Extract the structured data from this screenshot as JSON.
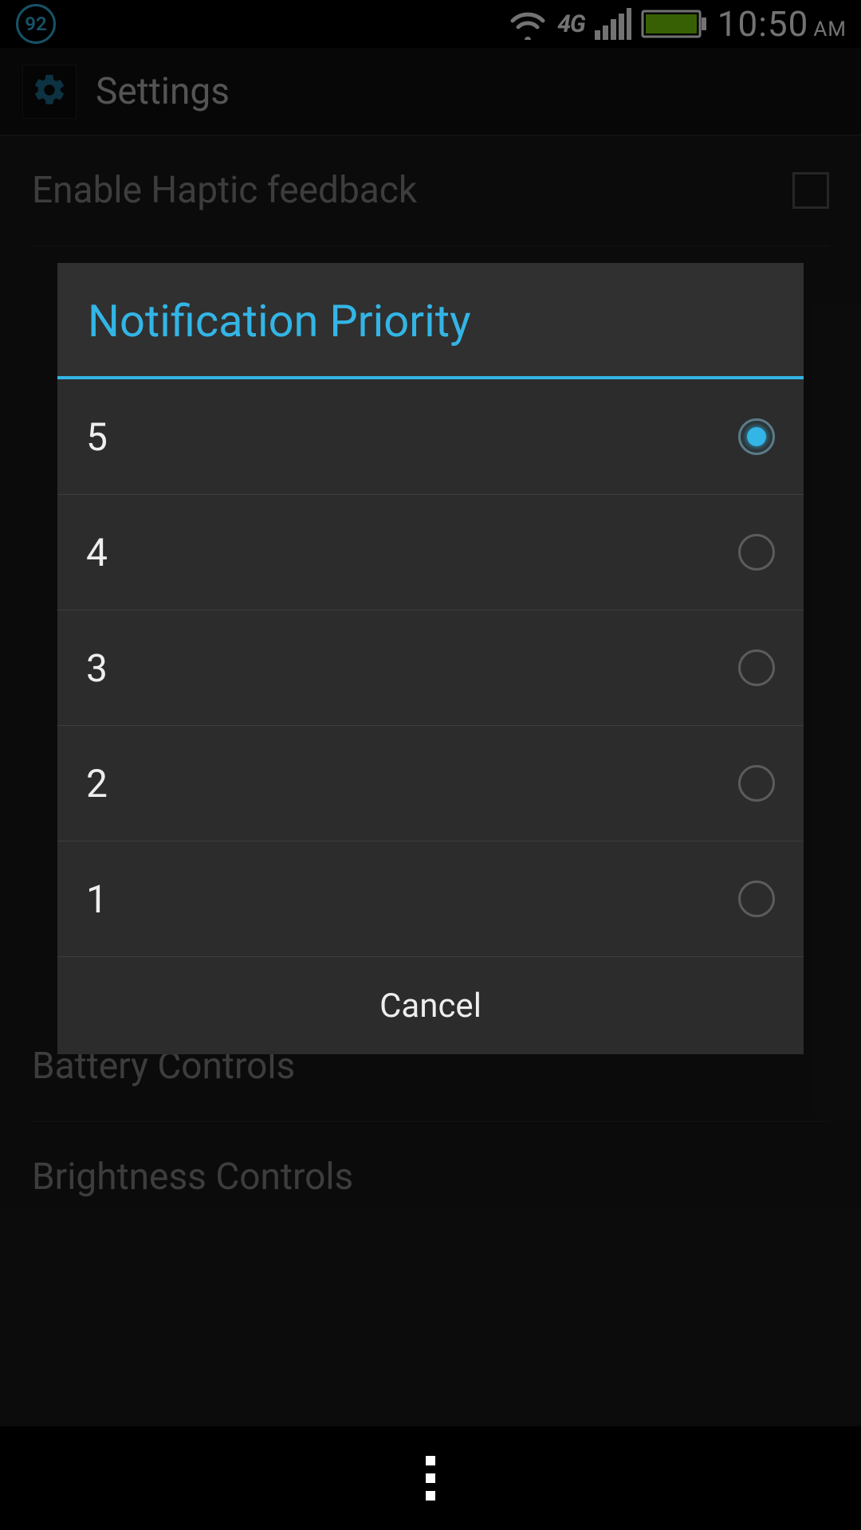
{
  "status_bar": {
    "badge_value": "92",
    "network_label": "4G",
    "time": "10:50",
    "ampm": "AM"
  },
  "app_bar": {
    "title": "Settings"
  },
  "settings_list": {
    "items": [
      {
        "label": "Enable Haptic feedback"
      },
      {
        "label": "Battery Controls"
      },
      {
        "label": "Brightness Controls"
      }
    ]
  },
  "dialog": {
    "title": "Notification Priority",
    "options": [
      {
        "label": "5",
        "selected": true
      },
      {
        "label": "4",
        "selected": false
      },
      {
        "label": "3",
        "selected": false
      },
      {
        "label": "2",
        "selected": false
      },
      {
        "label": "1",
        "selected": false
      }
    ],
    "cancel_label": "Cancel"
  }
}
